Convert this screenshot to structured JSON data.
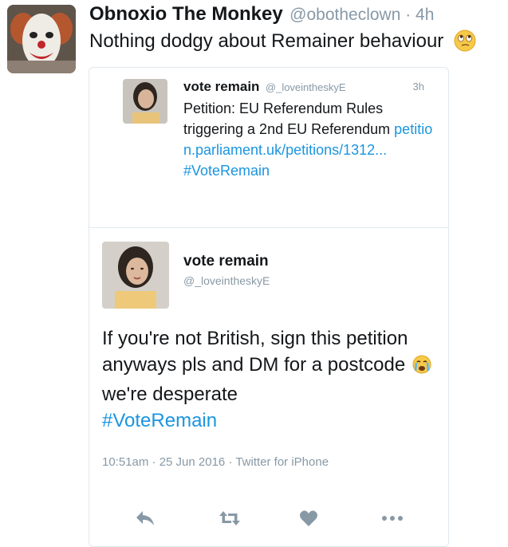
{
  "tweet": {
    "author_name": "Obnoxio The Monkey",
    "author_handle": "@obotheclown · 4h",
    "text": "Nothing dodgy about Remainer behaviour",
    "emoji": "face-with-rolling-eyes"
  },
  "quoted_tweet": {
    "author_name": "vote remain",
    "author_handle": "@_loveintheskyE",
    "time": "3h",
    "text": "Petition: EU Referendum Rules triggering a 2nd EU Referendum",
    "link": "petition.parliament.uk/petitions/1312...",
    "hashtag": "#VoteRemain"
  },
  "embedded_tweet": {
    "author_name": "vote remain",
    "author_handle": "@_loveintheskyE",
    "text_part1": "If you're not British, sign this petition anyways pls and DM for a postcode",
    "emoji": "loudly-crying-face",
    "text_part2": "we're desperate",
    "hashtag": "#VoteRemain",
    "meta": "10:51am · 25 Jun 2016 · Twitter for iPhone"
  },
  "actions": [
    "reply-icon",
    "retweet-icon",
    "like-icon",
    "more-icon"
  ],
  "colors": {
    "link": "#1b95e0",
    "muted": "#8899a6",
    "text": "#14171a",
    "border": "#e1e8ed"
  }
}
